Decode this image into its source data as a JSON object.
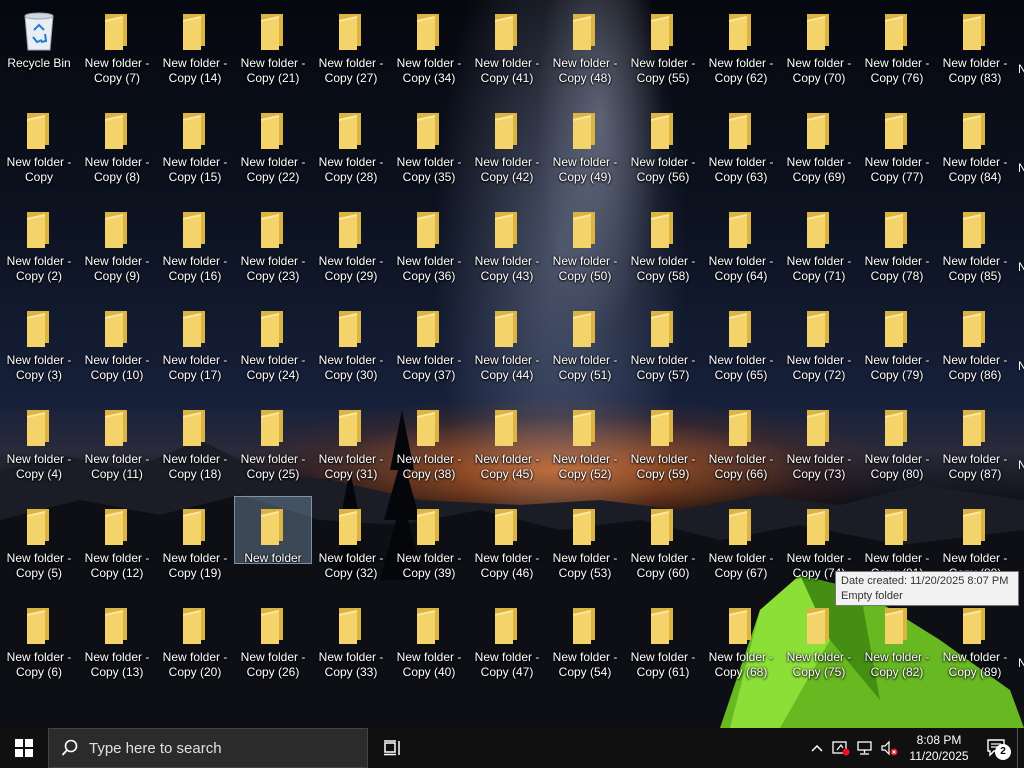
{
  "desktop": {
    "recycle_bin": "Recycle Bin",
    "columns": [
      [
        "",
        "New folder - Copy",
        "New folder - Copy (2)",
        "New folder - Copy (3)",
        "New folder - Copy (4)",
        "New folder - Copy (5)",
        "New folder - Copy (6)"
      ],
      [
        "New folder - Copy (7)",
        "New folder - Copy (8)",
        "New folder - Copy (9)",
        "New folder - Copy (10)",
        "New folder - Copy (11)",
        "New folder - Copy (12)",
        "New folder - Copy (13)"
      ],
      [
        "New folder - Copy (14)",
        "New folder - Copy (15)",
        "New folder - Copy (16)",
        "New folder - Copy (17)",
        "New folder - Copy (18)",
        "New folder - Copy (19)",
        "New folder - Copy (20)"
      ],
      [
        "New folder - Copy (21)",
        "New folder - Copy (22)",
        "New folder - Copy (23)",
        "New folder - Copy (24)",
        "New folder - Copy (25)",
        "New folder",
        "New folder - Copy (26)"
      ],
      [
        "New folder - Copy (27)",
        "New folder - Copy (28)",
        "New folder - Copy (29)",
        "New folder - Copy (30)",
        "New folder - Copy (31)",
        "New folder - Copy (32)",
        "New folder - Copy (33)"
      ],
      [
        "New folder - Copy (34)",
        "New folder - Copy (35)",
        "New folder - Copy (36)",
        "New folder - Copy (37)",
        "New folder - Copy (38)",
        "New folder - Copy (39)",
        "New folder - Copy (40)"
      ],
      [
        "New folder - Copy (41)",
        "New folder - Copy (42)",
        "New folder - Copy (43)",
        "New folder - Copy (44)",
        "New folder - Copy (45)",
        "New folder - Copy (46)",
        "New folder - Copy (47)"
      ],
      [
        "New folder - Copy (48)",
        "New folder - Copy (49)",
        "New folder - Copy (50)",
        "New folder - Copy (51)",
        "New folder - Copy (52)",
        "New folder - Copy (53)",
        "New folder - Copy (54)"
      ],
      [
        "New folder - Copy (55)",
        "New folder - Copy (56)",
        "New folder - Copy (58)",
        "New folder - Copy (57)",
        "New folder - Copy (59)",
        "New folder - Copy (60)",
        "New folder - Copy (61)"
      ],
      [
        "New folder - Copy (62)",
        "New folder - Copy (63)",
        "New folder - Copy (64)",
        "New folder - Copy (65)",
        "New folder - Copy (66)",
        "New folder - Copy (67)",
        "New folder - Copy (68)"
      ],
      [
        "New folder - Copy (70)",
        "New folder - Copy (69)",
        "New folder - Copy (71)",
        "New folder - Copy (72)",
        "New folder - Copy (73)",
        "New folder - Copy (74)",
        "New folder - Copy (75)"
      ],
      [
        "New folder - Copy (76)",
        "New folder - Copy (77)",
        "New folder - Copy (78)",
        "New folder - Copy (79)",
        "New folder - Copy (80)",
        "New folder - Copy (81)",
        "New folder - Copy (82)"
      ],
      [
        "New folder - Copy (83)",
        "New folder - Copy (84)",
        "New folder - Copy (85)",
        "New folder - Copy (86)",
        "New folder - Copy (87)",
        "New folder - Copy (88)",
        "New folder - Copy (89)"
      ]
    ],
    "selected_label": "New folder",
    "edge_glyph": "N"
  },
  "tooltip": {
    "line1": "Date created: 11/20/2025 8:07 PM",
    "line2": "Empty folder"
  },
  "taskbar": {
    "search_placeholder": "Type here to search",
    "clock_time": "8:08 PM",
    "clock_date": "11/20/2025",
    "notification_count": "2",
    "icons": [
      "windows-start-icon",
      "search-icon",
      "task-view-icon",
      "chevron-up-icon",
      "defender-alert-icon",
      "network-icon",
      "volume-muted-icon",
      "action-center-icon"
    ]
  },
  "colors": {
    "folder_front": "#f5d36b",
    "folder_back": "#dcb442",
    "taskbar_bg": "#101010"
  }
}
